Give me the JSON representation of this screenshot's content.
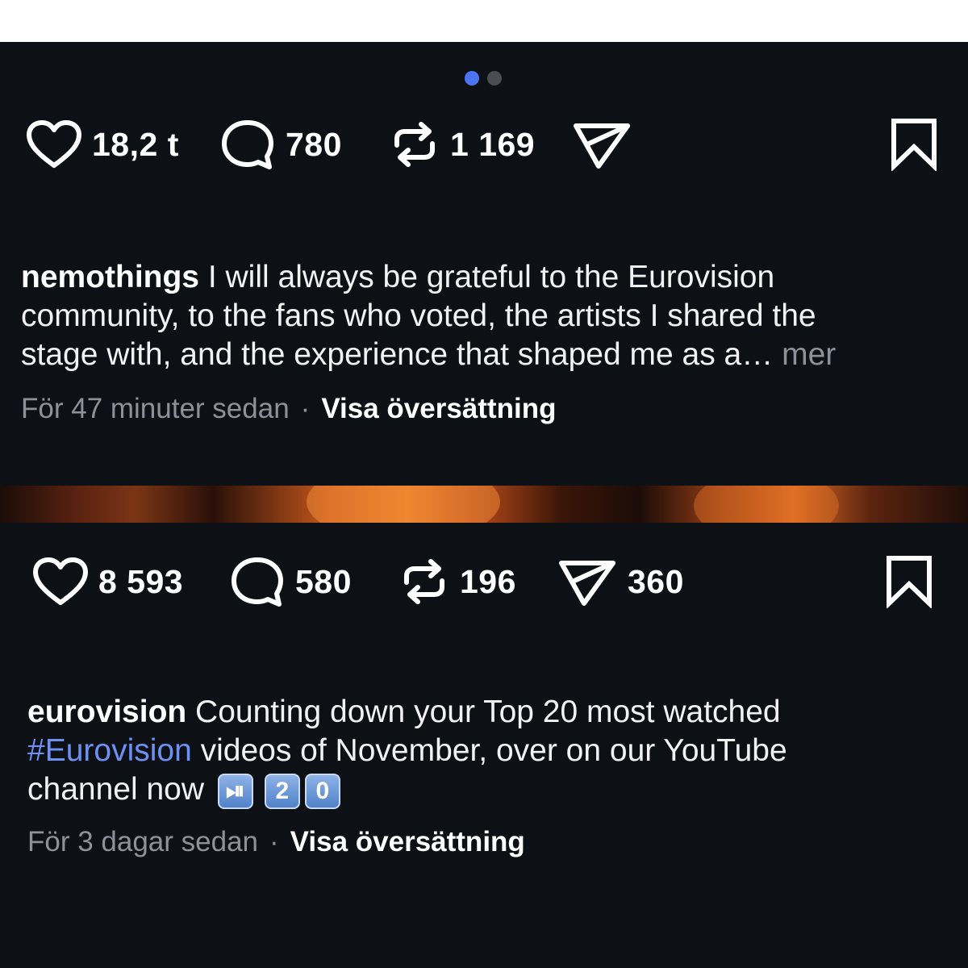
{
  "carousel": {
    "total": 2,
    "active": 1
  },
  "post1": {
    "likes": "18,2 t",
    "comments": "780",
    "reposts": "1 169",
    "username": "nemothings",
    "caption_line1": " I will always be grateful to the Eurovision",
    "caption_line2": "community, to the fans who voted, the artists I shared the",
    "caption_line3": "stage with, and the experience that shaped me as a… ",
    "more_label": "mer",
    "time": "För 47 minuter sedan",
    "separator": "·",
    "translate_label": "Visa översättning"
  },
  "post2": {
    "likes": "8 593",
    "comments": "580",
    "reposts": "196",
    "shares": "360",
    "username": "eurovision",
    "caption_line1": " Counting down your Top 20 most watched",
    "hashtag": "#Eurovision",
    "caption_line2_rest": " videos of November, over on our YouTube",
    "caption_line3": "channel now ",
    "emoji_playpause": "⏯",
    "emoji_digit1": "2",
    "emoji_digit2": "0",
    "time": "För 3 dagar sedan",
    "separator": "·",
    "translate_label": "Visa översättning"
  },
  "icons": {
    "like": "heart-icon",
    "comment": "comment-bubble-icon",
    "repost": "repost-icon",
    "share": "send-icon",
    "save": "bookmark-icon"
  },
  "colors": {
    "background": "#0d1116",
    "accent": "#4c74f0",
    "hashtag": "#6f8ff5",
    "muted": "#8d9199"
  }
}
